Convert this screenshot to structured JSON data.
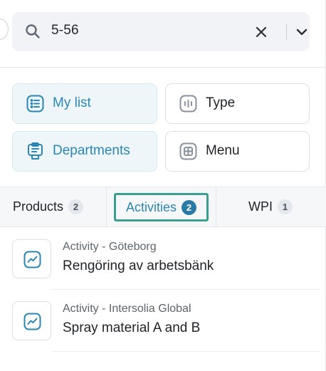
{
  "search": {
    "value": "5-56"
  },
  "filters": [
    {
      "label": "My list",
      "icon": "list-icon",
      "active": true
    },
    {
      "label": "Type",
      "icon": "audio-wave-icon",
      "active": false
    },
    {
      "label": "Departments",
      "icon": "clipboard-icon",
      "active": true
    },
    {
      "label": "Menu",
      "icon": "grid-plus-icon",
      "active": false
    }
  ],
  "tabs": [
    {
      "label": "Products",
      "count": "2",
      "active": false
    },
    {
      "label": "Activities",
      "count": "2",
      "active": true
    },
    {
      "label": "WPI",
      "count": "1",
      "active": false
    }
  ],
  "results": [
    {
      "subtitle": "Activity - Göteborg",
      "title": "Rengöring av arbetsbänk",
      "icon": "activity-chart-icon"
    },
    {
      "subtitle": "Activity - Intersolia Global",
      "title": "Spray material A and B",
      "icon": "activity-chart-icon"
    }
  ],
  "colors": {
    "accent": "#2c86b3",
    "active_bg": "#eef6f9",
    "focus_ring": "#3b9f90",
    "badge_active": "#2a7aa6"
  }
}
